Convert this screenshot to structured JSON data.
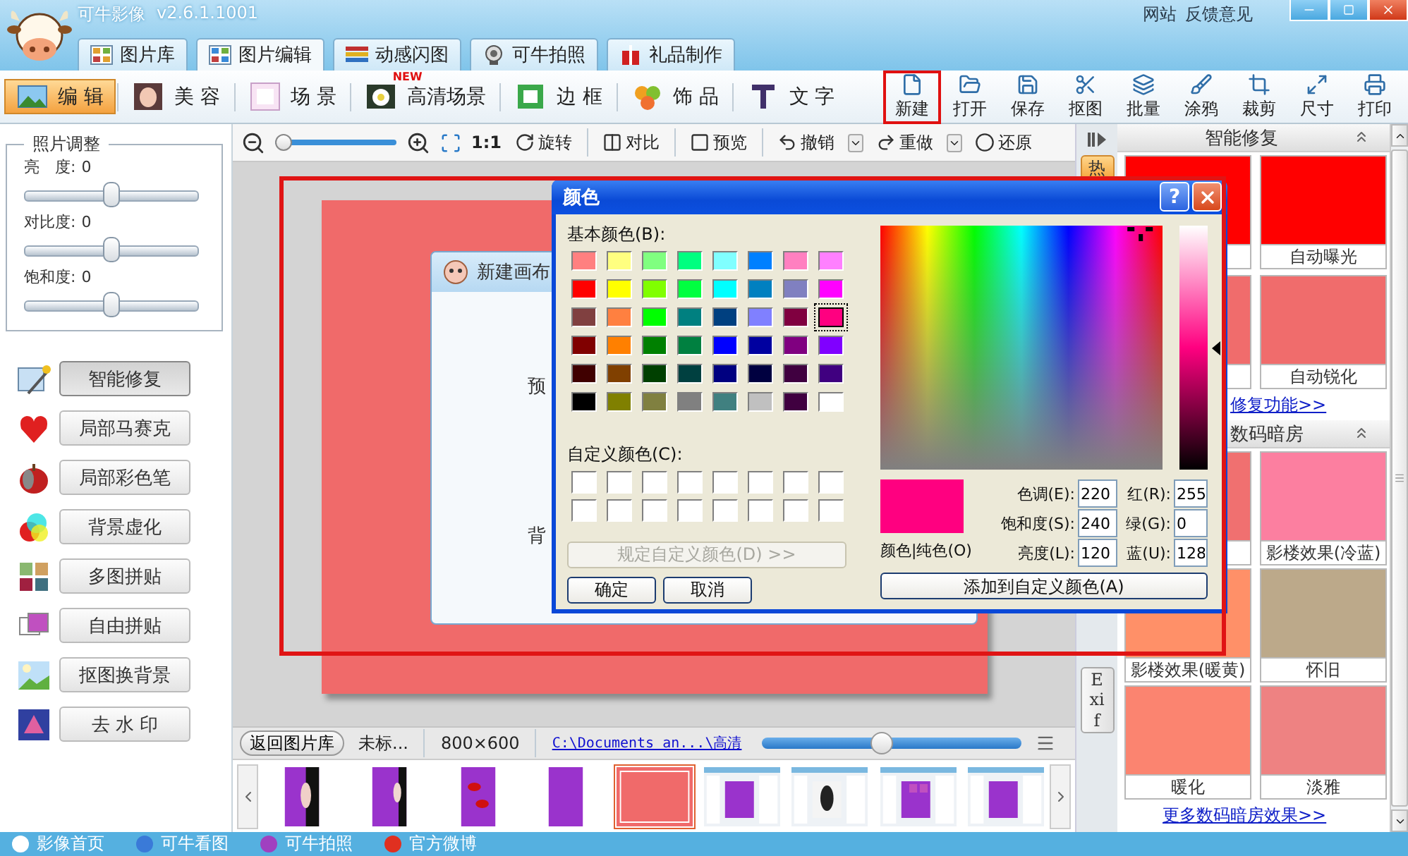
{
  "title_bar": {
    "app_name": "可牛影像",
    "version": "v2.6.1.1001",
    "links": [
      "网站",
      "反馈意见"
    ]
  },
  "main_tabs": [
    {
      "label": "图片库",
      "selected": false
    },
    {
      "label": "图片编辑",
      "selected": true
    },
    {
      "label": "动感闪图",
      "selected": false
    },
    {
      "label": "可牛拍照",
      "selected": false
    },
    {
      "label": "礼品制作",
      "selected": false
    }
  ],
  "mode_tabs": [
    {
      "label": "编 辑",
      "selected": true
    },
    {
      "label": "美 容",
      "selected": false
    },
    {
      "label": "场 景",
      "selected": false
    },
    {
      "label": "高清场景",
      "selected": false,
      "badge": "NEW"
    },
    {
      "label": "边 框",
      "selected": false
    },
    {
      "label": "饰 品",
      "selected": false
    },
    {
      "label": "文 字",
      "selected": false
    }
  ],
  "tools": [
    {
      "label": "新建",
      "highlighted": true
    },
    {
      "label": "打开",
      "highlighted": false
    },
    {
      "label": "保存",
      "highlighted": false
    },
    {
      "label": "抠图",
      "highlighted": false
    },
    {
      "label": "批量",
      "highlighted": false
    },
    {
      "label": "涂鸦",
      "highlighted": false
    },
    {
      "label": "裁剪",
      "highlighted": false
    },
    {
      "label": "尺寸",
      "highlighted": false
    },
    {
      "label": "打印",
      "highlighted": false
    }
  ],
  "photo_adjust": {
    "title": "照片调整",
    "sliders": [
      {
        "label": "亮　度:",
        "value": "0",
        "level": 0.5
      },
      {
        "label": "对比度:",
        "value": "0",
        "level": 0.5
      },
      {
        "label": "饱和度:",
        "value": "0",
        "level": 0.5
      }
    ]
  },
  "features": [
    {
      "label": "智能修复",
      "selected": true
    },
    {
      "label": "局部马赛克",
      "selected": false
    },
    {
      "label": "局部彩色笔",
      "selected": false
    },
    {
      "label": "背景虚化",
      "selected": false
    },
    {
      "label": "多图拼贴",
      "selected": false
    },
    {
      "label": "自由拼贴",
      "selected": false
    },
    {
      "label": "抠图换背景",
      "selected": false
    },
    {
      "label": "去 水 印",
      "selected": false
    }
  ],
  "edit_toolbar": {
    "zoom": {
      "level": 0
    },
    "actual_size": "1:1",
    "buttons": [
      {
        "label": "旋转",
        "dropdown": false
      },
      {
        "label": "对比",
        "dropdown": false
      },
      {
        "label": "预览",
        "dropdown": false
      },
      {
        "label": "撤销",
        "dropdown": true
      },
      {
        "label": "重做",
        "dropdown": true
      },
      {
        "label": "还原",
        "dropdown": false
      }
    ]
  },
  "canvas_dialog": {
    "title": "新建画布",
    "labels": [
      "预",
      "背"
    ]
  },
  "color_dialog": {
    "title": "颜色",
    "help": "?",
    "basic_label": "基本颜色(B):",
    "basic_colors": [
      {
        "color": "#ff8080",
        "selected": false
      },
      {
        "color": "#ffff80",
        "selected": false
      },
      {
        "color": "#80ff80",
        "selected": false
      },
      {
        "color": "#00ff80",
        "selected": false
      },
      {
        "color": "#80ffff",
        "selected": false
      },
      {
        "color": "#0080ff",
        "selected": false
      },
      {
        "color": "#ff80c0",
        "selected": false
      },
      {
        "color": "#ff80ff",
        "selected": false
      },
      {
        "color": "#ff0000",
        "selected": false
      },
      {
        "color": "#ffff00",
        "selected": false
      },
      {
        "color": "#80ff00",
        "selected": false
      },
      {
        "color": "#00ff40",
        "selected": false
      },
      {
        "color": "#00ffff",
        "selected": false
      },
      {
        "color": "#0080c0",
        "selected": false
      },
      {
        "color": "#8080c0",
        "selected": false
      },
      {
        "color": "#ff00ff",
        "selected": false
      },
      {
        "color": "#804040",
        "selected": false
      },
      {
        "color": "#ff8040",
        "selected": false
      },
      {
        "color": "#00ff00",
        "selected": false
      },
      {
        "color": "#008080",
        "selected": false
      },
      {
        "color": "#004080",
        "selected": false
      },
      {
        "color": "#8080ff",
        "selected": false
      },
      {
        "color": "#800040",
        "selected": false
      },
      {
        "color": "#ff0080",
        "selected": true
      },
      {
        "color": "#800000",
        "selected": false
      },
      {
        "color": "#ff8000",
        "selected": false
      },
      {
        "color": "#008000",
        "selected": false
      },
      {
        "color": "#008040",
        "selected": false
      },
      {
        "color": "#0000ff",
        "selected": false
      },
      {
        "color": "#0000a0",
        "selected": false
      },
      {
        "color": "#800080",
        "selected": false
      },
      {
        "color": "#8000ff",
        "selected": false
      },
      {
        "color": "#400000",
        "selected": false
      },
      {
        "color": "#804000",
        "selected": false
      },
      {
        "color": "#004000",
        "selected": false
      },
      {
        "color": "#004040",
        "selected": false
      },
      {
        "color": "#000080",
        "selected": false
      },
      {
        "color": "#000040",
        "selected": false
      },
      {
        "color": "#400040",
        "selected": false
      },
      {
        "color": "#400080",
        "selected": false
      },
      {
        "color": "#000000",
        "selected": false
      },
      {
        "color": "#808000",
        "selected": false
      },
      {
        "color": "#808040",
        "selected": false
      },
      {
        "color": "#808080",
        "selected": false
      },
      {
        "color": "#408080",
        "selected": false
      },
      {
        "color": "#c0c0c0",
        "selected": false
      },
      {
        "color": "#400040",
        "selected": false
      },
      {
        "color": "#ffffff",
        "selected": false
      }
    ],
    "custom_label": "自定义颜色(C):",
    "define_button": {
      "label": "规定自定义颜色(D) >>",
      "disabled": true
    },
    "ok": "确定",
    "cancel": "取消",
    "preview_label": "颜色|纯色(O)",
    "fields": [
      {
        "label": "色调(E):",
        "value": "220"
      },
      {
        "label": "红(R):",
        "value": "255"
      },
      {
        "label": "饱和度(S):",
        "value": "240"
      },
      {
        "label": "绿(G):",
        "value": "0"
      },
      {
        "label": "亮度(L):",
        "value": "120"
      },
      {
        "label": "蓝(U):",
        "value": "128"
      }
    ],
    "add_button": "添加到自定义颜色(A)"
  },
  "info_bar": {
    "back_button": "返回图片库",
    "file_name": "未标...",
    "dimensions": "800×600",
    "path": "C:\\Documents an...\\高清",
    "zoom": {
      "level": 0.46
    }
  },
  "thumbnails": [
    {
      "kind": "picture",
      "selected": false
    },
    {
      "kind": "picture",
      "selected": false
    },
    {
      "kind": "picture",
      "selected": false
    },
    {
      "kind": "picture",
      "selected": false
    },
    {
      "kind": "picture",
      "selected": true
    },
    {
      "kind": "picture",
      "selected": false
    },
    {
      "kind": "picture",
      "selected": false
    },
    {
      "kind": "picture",
      "selected": false
    },
    {
      "kind": "picture",
      "selected": false
    }
  ],
  "side_tabs": [
    {
      "label": "热",
      "selected": true
    },
    {
      "label": "Exif",
      "selected": false
    }
  ],
  "sections": [
    {
      "title": "智能修复",
      "tiles": [
        {
          "color": "#ff0000"
        },
        {
          "label": "自动曝光",
          "color": "#ff0000"
        },
        {
          "color": "#f06c6c"
        },
        {
          "label": "自动锐化",
          "color": "#f06c6c"
        }
      ],
      "link": "修复功能>>"
    },
    {
      "title": "数码暗房",
      "tiles": [
        {
          "color": "#f07070"
        },
        {
          "label": "影楼效果(冷蓝)",
          "color": "#fc7fa0"
        },
        {
          "label": "影楼效果(暖黄)",
          "color": "#ff9068"
        },
        {
          "label": "怀旧",
          "color": "#bca98a"
        },
        {
          "label": "暖化",
          "color": "#fb8470"
        },
        {
          "label": "淡雅",
          "color": "#ee8282"
        }
      ],
      "link": "更多数码暗房效果>>"
    }
  ],
  "status_bar": {
    "links": [
      "影像首页",
      "可牛看图",
      "可牛拍照",
      "官方微博"
    ]
  }
}
